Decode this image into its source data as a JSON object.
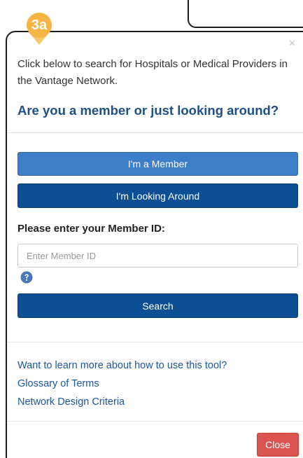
{
  "step_badge": {
    "label": "3a",
    "color": "#f5b544"
  },
  "modal": {
    "close_icon": "close-icon",
    "intro_text": "Click below to search for Hospitals or Medical Providers in the Vantage Network.",
    "question": "Are you a member or just looking around?",
    "member_button_label": "I'm a Member",
    "looking_button_label": "I'm Looking Around",
    "member_id_label": "Please enter your Member ID:",
    "member_id_placeholder": "Enter Member ID",
    "member_id_value": "",
    "help_icon": "question-circle-icon",
    "search_button_label": "Search",
    "links": [
      "Want to learn more about how to use this tool?",
      "Glossary of Terms",
      "Network Design Criteria"
    ],
    "close_button_label": "Close"
  },
  "colors": {
    "primary_dark": "#0d4f94",
    "primary_light": "#3d7fc8",
    "heading": "#1e4f86",
    "link": "#1a56a3",
    "danger": "#d9534f"
  }
}
